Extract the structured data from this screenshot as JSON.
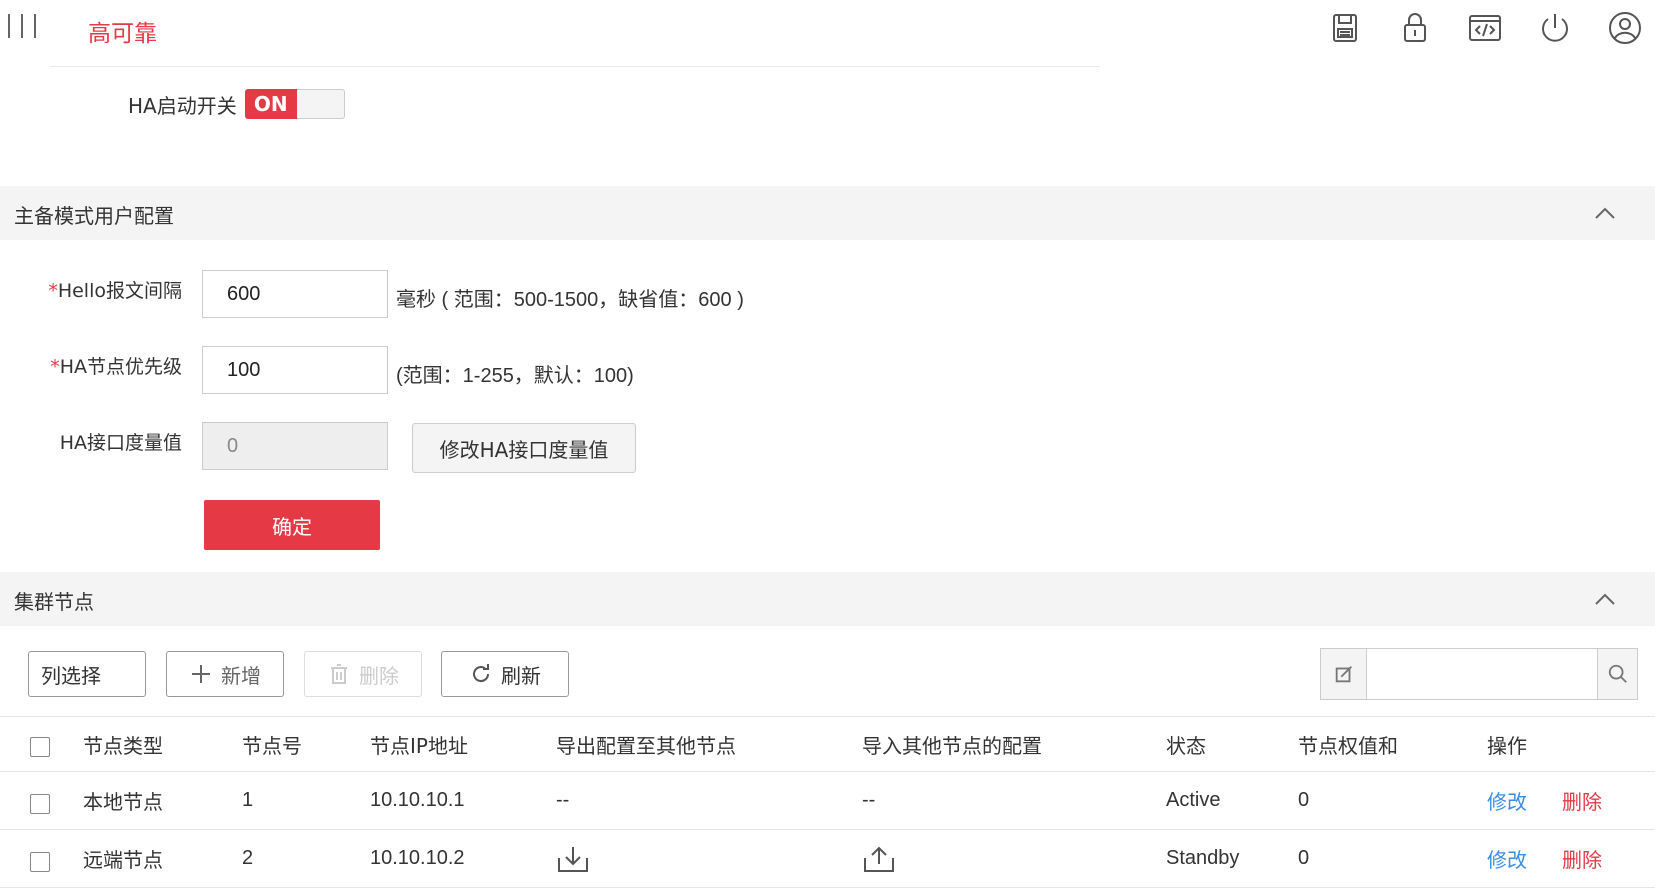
{
  "app": {
    "title": "高可靠"
  },
  "header_icons": [
    "save-icon",
    "lock-icon",
    "code-icon",
    "power-icon",
    "user-icon"
  ],
  "ha_switch": {
    "label": "HA启动开关",
    "state": "ON"
  },
  "section_master": {
    "title": "主备模式用户配置"
  },
  "form": {
    "hello_label": "Hello报文间隔",
    "hello_value": "600",
    "hello_hint": "毫秒 ( 范围：500-1500，缺省值：600 )",
    "priority_label": "HA节点优先级",
    "priority_value": "100",
    "priority_hint": "(范围：1-255，默认：100)",
    "metric_label": "HA接口度量值",
    "metric_value": "0",
    "metric_button": "修改HA接口度量值",
    "required_mark": "*",
    "submit": "确定"
  },
  "section_cluster": {
    "title": "集群节点"
  },
  "toolbar": {
    "column_select": "列选择",
    "add": "新增",
    "delete": "删除",
    "refresh": "刷新"
  },
  "table": {
    "headers": [
      "节点类型",
      "节点号",
      "节点IP地址",
      "导出配置至其他节点",
      "导入其他节点的配置",
      "状态",
      "节点权值和",
      "操作"
    ],
    "rows": [
      {
        "type": "本地节点",
        "no": "1",
        "ip": "10.10.10.1",
        "export": "--",
        "import": "--",
        "status": "Active",
        "weight": "0",
        "edit": "修改",
        "del": "删除"
      },
      {
        "type": "远端节点",
        "no": "2",
        "ip": "10.10.10.2",
        "export_icon": "download-icon",
        "import_icon": "upload-icon",
        "status": "Standby",
        "weight": "0",
        "edit": "修改",
        "del": "删除"
      }
    ]
  },
  "colors": {
    "accent": "#e53945",
    "link": "#3a8ee6",
    "section_bg": "#f4f4f4"
  }
}
